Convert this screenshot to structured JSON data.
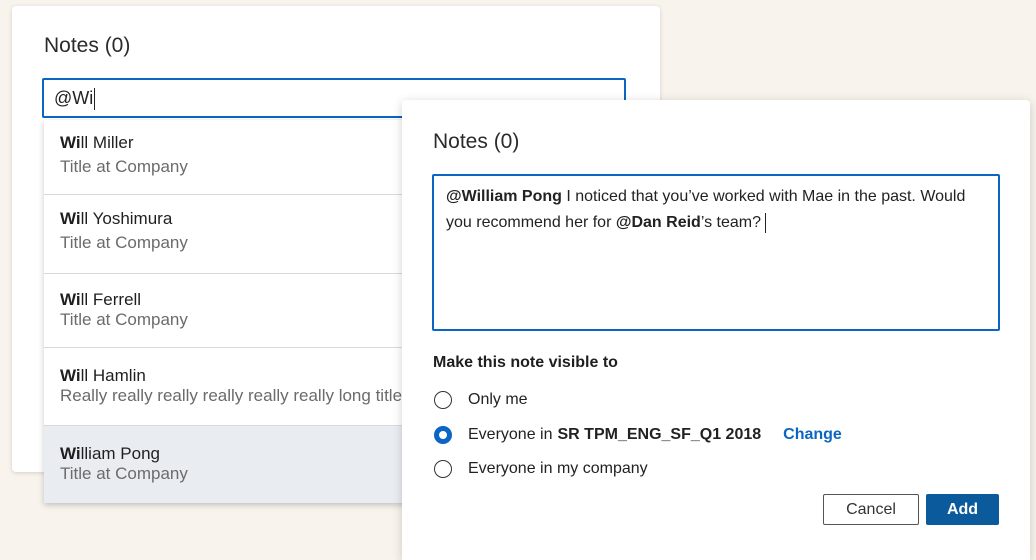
{
  "left_panel": {
    "title": "Notes (0)",
    "input_value": "@Wi"
  },
  "suggestions": [
    {
      "match": "Wi",
      "rest": "ll Miller",
      "subtitle": "Title at Company"
    },
    {
      "match": "Wi",
      "rest": "ll Yoshimura",
      "subtitle": "Title at Company"
    },
    {
      "match": "Wi",
      "rest": "ll Ferrell",
      "subtitle": "Title at Company"
    },
    {
      "match": "Wi",
      "rest": "ll Hamlin",
      "subtitle": "Really really really really really really long title"
    },
    {
      "match": "Wi",
      "rest": "lliam Pong",
      "subtitle": "Title at Company",
      "selected": true
    }
  ],
  "right_panel": {
    "title": "Notes (0)",
    "note": {
      "mention1": "@William Pong",
      "text1": " I noticed that you’ve worked with Mae in the past. Would you recommend her for ",
      "mention2": "@Dan Reid",
      "text2": "’s team?"
    },
    "visibility": {
      "heading": "Make this note visible to",
      "options": [
        {
          "label": "Only me",
          "checked": false
        },
        {
          "label": "Everyone in",
          "group": "SR TPM_ENG_SF_Q1 2018",
          "link": "Change",
          "checked": true
        },
        {
          "label": "Everyone in my company",
          "checked": false
        }
      ]
    },
    "buttons": {
      "cancel": "Cancel",
      "add": "Add"
    }
  },
  "colors": {
    "accent": "#0a66c2",
    "primary_button": "#0a5a9c",
    "page_background": "#f8f3ec",
    "selected_row": "#e9edf2"
  }
}
